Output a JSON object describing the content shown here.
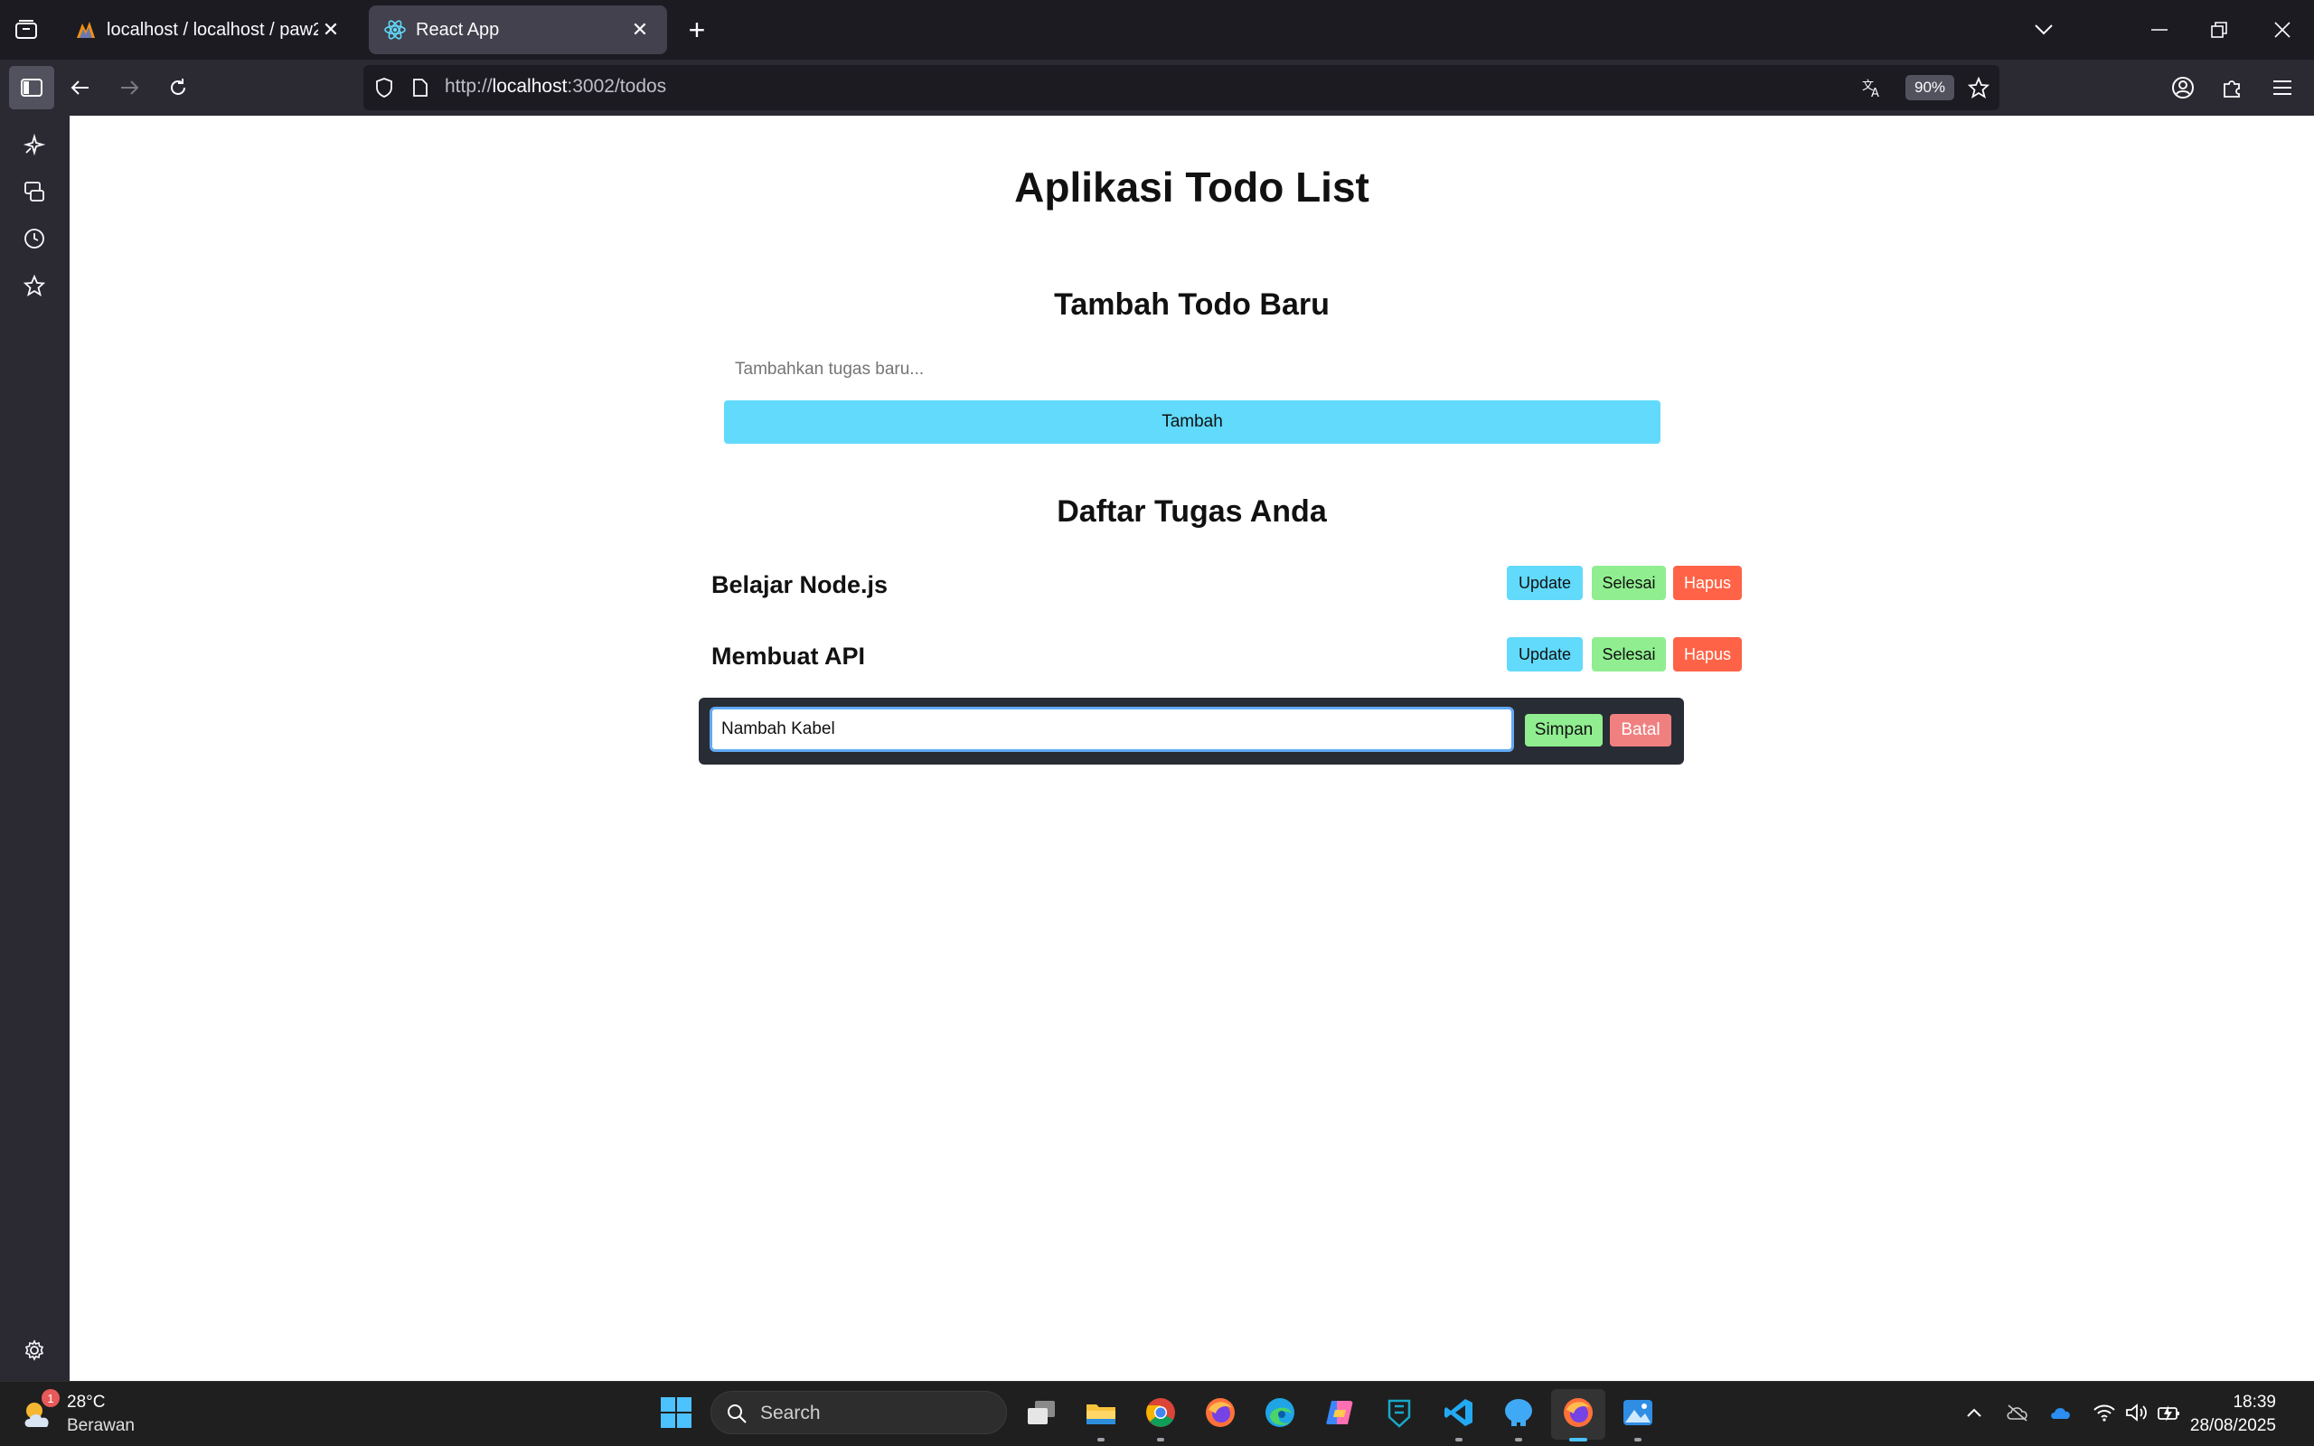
{
  "browser": {
    "tabs": [
      {
        "title": "localhost / localhost / paw2025",
        "favicon": "phpmyadmin-icon",
        "active": false
      },
      {
        "title": "React App",
        "favicon": "react-icon",
        "active": true
      }
    ],
    "url_scheme": "http://",
    "url_host": "localhost",
    "url_rest": ":3002/todos",
    "zoom": "90%"
  },
  "page": {
    "title": "Aplikasi Todo List",
    "add_section_title": "Tambah Todo Baru",
    "new_todo_placeholder": "Tambahkan tugas baru...",
    "add_button": "Tambah",
    "list_title": "Daftar Tugas Anda",
    "todos": [
      {
        "text": "Belajar Node.js",
        "update": "Update",
        "done": "Selesai",
        "delete": "Hapus"
      },
      {
        "text": "Membuat API",
        "update": "Update",
        "done": "Selesai",
        "delete": "Hapus"
      }
    ],
    "editing": {
      "value": "Nambah Kabel",
      "save": "Simpan",
      "cancel": "Batal"
    }
  },
  "taskbar": {
    "weather_temp": "28°C",
    "weather_desc": "Berawan",
    "weather_badge": "1",
    "search_label": "Search",
    "time": "18:39",
    "date": "28/08/2025"
  },
  "colors": {
    "accent_blue": "#61dafb",
    "accent_green": "#90ee90",
    "accent_red": "#ff6347",
    "edit_bg": "#282c34",
    "cancel_red": "#f08080"
  }
}
